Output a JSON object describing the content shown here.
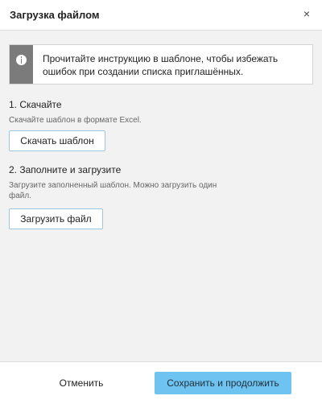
{
  "dialog": {
    "title": "Загрузка файлом",
    "close_glyph": "×"
  },
  "notice": {
    "icon": "info-icon",
    "text": "Прочитайте инструкцию в шаблоне, чтобы избежать ошибок при создании списка приглашённых."
  },
  "steps": [
    {
      "heading": "1. Скачайте",
      "description": "Скачайте шаблон в формате Excel.",
      "button_label": "Скачать шаблон"
    },
    {
      "heading": "2. Заполните и загрузите",
      "description": "Загрузите заполненный шаблон. Можно загрузить один файл.",
      "button_label": "Загрузить файл"
    }
  ],
  "footer": {
    "cancel_label": "Отменить",
    "submit_label": "Сохранить и продолжить"
  },
  "colors": {
    "primary": "#6ec3f0",
    "button_border": "#9cc7e3",
    "notice_bar": "#7b7b7b",
    "background": "#f2f2f2"
  }
}
